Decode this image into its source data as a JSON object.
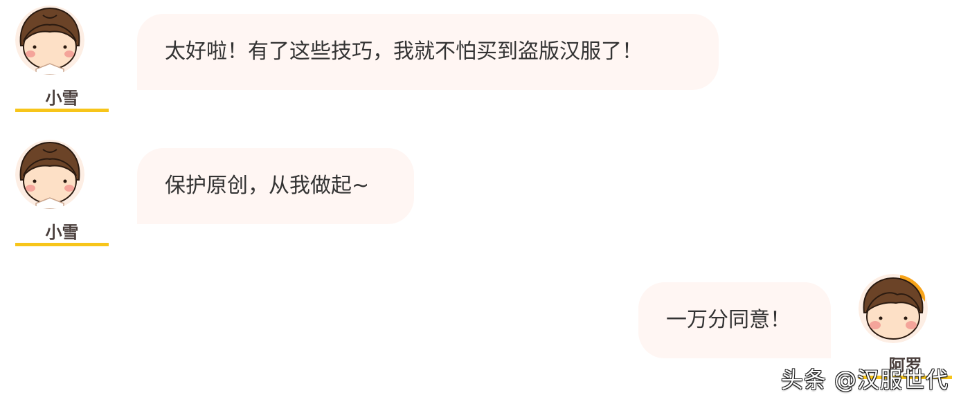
{
  "messages": [
    {
      "sender": "小雪",
      "side": "left",
      "text": "太好啦！有了这些技巧，我就不怕买到盗版汉服了！"
    },
    {
      "sender": "小雪",
      "side": "left",
      "text": "保护原创，从我做起~"
    },
    {
      "sender": "阿罗",
      "side": "right",
      "text": "一万分同意！"
    }
  ],
  "watermark": "头条 @汉服世代",
  "colors": {
    "bubble_bg": "#fff6f3",
    "name_underline": "#f7c51a",
    "hair": "#6b4327",
    "skin": "#fde0c6",
    "blush": "#f4a49a"
  }
}
